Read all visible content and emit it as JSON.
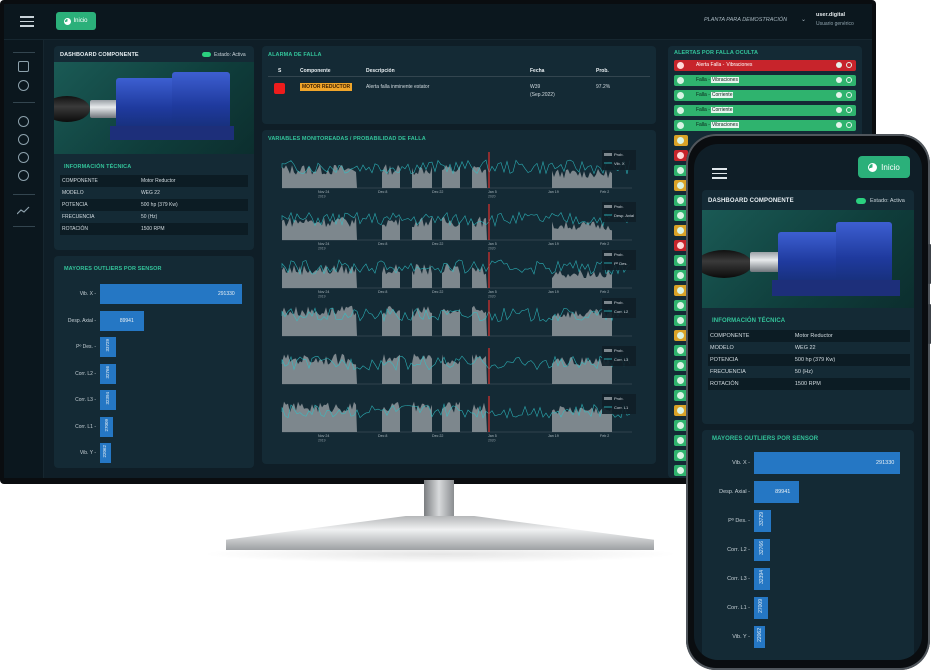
{
  "topbar": {
    "inicio_label": "Inicio",
    "plant": "PLANTA PARA DEMOSTRACIÓN",
    "user_name": "user.digital",
    "user_role": "Usuario genérico"
  },
  "component_card": {
    "title": "DASHBOARD COMPONENTE",
    "status_label": "Estado: Activa"
  },
  "tech_info": {
    "title": "INFORMACIÓN TÉCNICA",
    "rows": [
      {
        "key": "COMPONENTE",
        "value": "Motor Reductor"
      },
      {
        "key": "MODELO",
        "value": "WEG 22"
      },
      {
        "key": "POTENCIA",
        "value": "500 hp (379 Kw)"
      },
      {
        "key": "FRECUENCIA",
        "value": "50 (Hz)"
      },
      {
        "key": "ROTACIÓN",
        "value": "1500 RPM"
      }
    ]
  },
  "outliers": {
    "title": "MAYORES OUTLIERS POR SENSOR",
    "max": 291330,
    "items": [
      {
        "label": "Vib. X",
        "value": 291330,
        "text": "291330"
      },
      {
        "label": "Desp. Axial",
        "value": 89941,
        "text": "89941"
      },
      {
        "label": "Pº Des.",
        "value": 33729,
        "text": "33729"
      },
      {
        "label": "Corr. L2",
        "value": 32766,
        "text": "32766"
      },
      {
        "label": "Corr. L3",
        "value": 32394,
        "text": "32394"
      },
      {
        "label": "Corr. L1",
        "value": 27009,
        "text": "27009"
      },
      {
        "label": "Vib. Y",
        "value": 22062,
        "text": "22062"
      }
    ]
  },
  "alarm": {
    "title": "ALARMA DE FALLA",
    "headers": {
      "s": "S",
      "component": "Componente",
      "description": "Descripción",
      "date": "Fecha",
      "prob": "Prob."
    },
    "row": {
      "component": "MOTOR REDUCTOR",
      "description": "Alerta falla inminente estator",
      "date": "W39",
      "date_sub": "(Sep.2022)",
      "prob": "97.2%",
      "status_color": "#ee1c1c"
    }
  },
  "variables": {
    "title": "VARIABLES MONITOREADAS / PROBABILIDAD DE FALLA",
    "prob_label": "Prob.",
    "charts": [
      {
        "series": "Vib. X",
        "x_top": [
          "Nov 24",
          "Dec 8",
          "Dec 22",
          "Jan 5",
          "Jan 19",
          "Feb 2"
        ],
        "x_top_years": [
          "2019",
          "",
          "",
          "2020",
          "",
          ""
        ]
      },
      {
        "series": "Desp. Axial",
        "x_top": [
          "Nov 24",
          "Dec 8",
          "Dec 22",
          "Jan 5",
          "Jan 19",
          "Feb 2"
        ],
        "x_top_years": [
          "2019",
          "",
          "",
          "2020",
          "",
          ""
        ]
      },
      {
        "series": "Pº Des.",
        "x_top": [
          "Nov 24",
          "Dec 8",
          "Dec 22",
          "Jan 5",
          "Jan 19",
          "Feb 2"
        ],
        "x_top_years": [
          "2019",
          "",
          "",
          "2020",
          "",
          ""
        ]
      },
      {
        "series": "Corr. L2",
        "x_top": [],
        "x_top_years": []
      },
      {
        "series": "Corr. L3",
        "x_top": [],
        "x_top_years": []
      },
      {
        "series": "Corr. L1",
        "x_top": [
          "Nov 24",
          "Dec 8",
          "Dec 22",
          "Jan 5",
          "Jan 19",
          "Feb 2"
        ],
        "x_top_years": [
          "2019",
          "",
          "",
          "2020",
          "",
          ""
        ]
      }
    ]
  },
  "hidden_alerts": {
    "title": "ALERTAS POR FALLA OCULTA",
    "items": [
      {
        "type": "red",
        "prefix": "Alerta Falla",
        "tag": "Vibraciones"
      },
      {
        "type": "green",
        "prefix": "Falla",
        "tag": "Vibraciones"
      },
      {
        "type": "green",
        "prefix": "Falla",
        "tag": "Corriente"
      },
      {
        "type": "green",
        "prefix": "Falla",
        "tag": "Corriente"
      },
      {
        "type": "green",
        "prefix": "Falla",
        "tag": "Vibraciones"
      }
    ],
    "colors": {
      "green": "#2fb36e",
      "red": "#c7242b",
      "yellow": "#d9a227"
    }
  }
}
